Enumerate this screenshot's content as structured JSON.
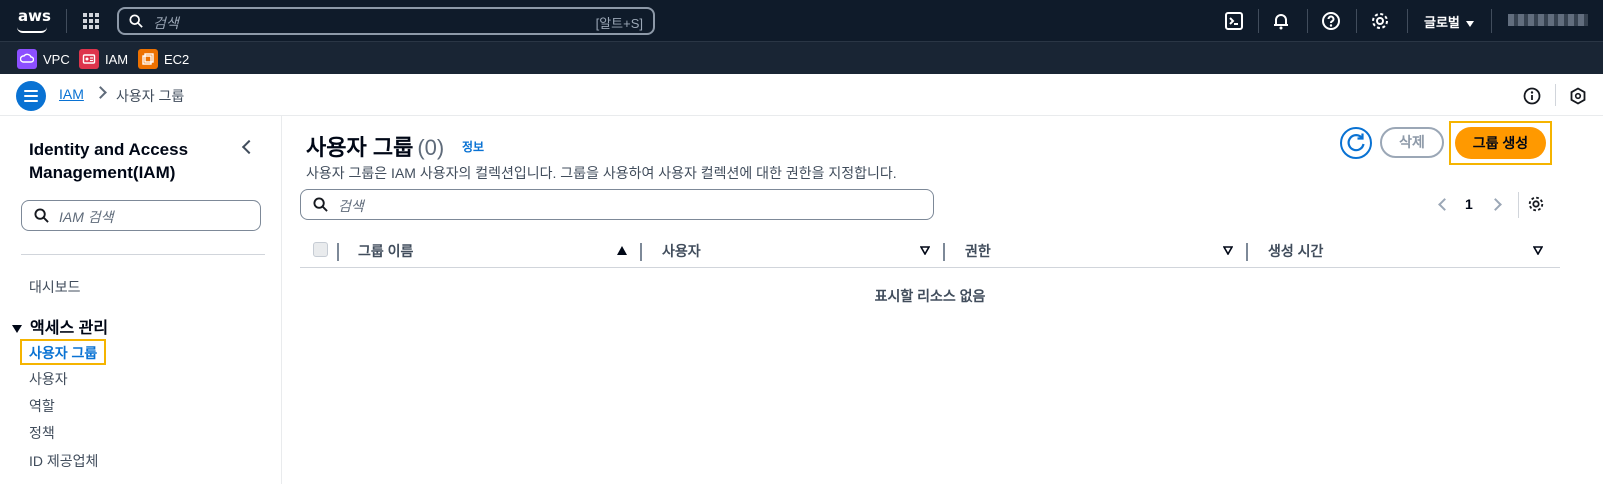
{
  "top_nav": {
    "logo_text": "aws",
    "search_placeholder": "검색",
    "search_shortcut": "[알트+S]",
    "region_label": "글로벌",
    "icons": [
      "services-grid-icon",
      "search-icon",
      "cloudshell-icon",
      "bell-icon",
      "help-icon",
      "gear-icon"
    ]
  },
  "favorites": [
    {
      "label": "VPC",
      "color": "#8c4fff",
      "icon": "vpc-icon"
    },
    {
      "label": "IAM",
      "color": "#dd344c",
      "icon": "iam-icon"
    },
    {
      "label": "EC2",
      "color": "#ed7100",
      "icon": "ec2-icon"
    }
  ],
  "breadcrumb": {
    "root": "IAM",
    "current": "사용자 그룹"
  },
  "sidebar": {
    "title": "Identity and Access Management(IAM)",
    "search_placeholder": "IAM 검색",
    "dashboard": "대시보드",
    "group_label": "액세스 관리",
    "items": [
      {
        "label": "사용자 그룹",
        "active": true
      },
      {
        "label": "사용자"
      },
      {
        "label": "역할"
      },
      {
        "label": "정책"
      },
      {
        "label": "ID 제공업체"
      }
    ]
  },
  "main": {
    "title": "사용자 그룹",
    "count": "(0)",
    "info_link": "정보",
    "description": "사용자 그룹은 IAM 사용자의 컬렉션입니다. 그룹을 사용하여 사용자 컬렉션에 대한 권한을 지정합니다.",
    "delete_button": "삭제",
    "create_button": "그룹 생성",
    "search_placeholder": "검색",
    "page_number": "1",
    "columns": [
      "그룹 이름",
      "사용자",
      "권한",
      "생성 시간"
    ],
    "empty_text": "표시할 리소스 없음"
  },
  "colors": {
    "nav_bg": "#0f1b2a",
    "link_blue": "#0972d3",
    "primary_orange": "#ff9900",
    "highlight_yellow": "#f5b400"
  }
}
